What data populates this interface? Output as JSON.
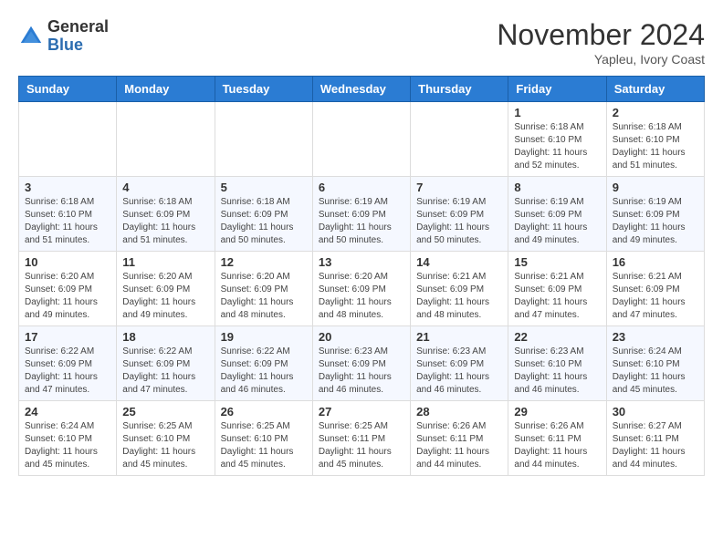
{
  "logo": {
    "general": "General",
    "blue": "Blue"
  },
  "title": "November 2024",
  "location": "Yapleu, Ivory Coast",
  "days_of_week": [
    "Sunday",
    "Monday",
    "Tuesday",
    "Wednesday",
    "Thursday",
    "Friday",
    "Saturday"
  ],
  "weeks": [
    [
      {
        "day": "",
        "detail": ""
      },
      {
        "day": "",
        "detail": ""
      },
      {
        "day": "",
        "detail": ""
      },
      {
        "day": "",
        "detail": ""
      },
      {
        "day": "",
        "detail": ""
      },
      {
        "day": "1",
        "detail": "Sunrise: 6:18 AM\nSunset: 6:10 PM\nDaylight: 11 hours and 52 minutes."
      },
      {
        "day": "2",
        "detail": "Sunrise: 6:18 AM\nSunset: 6:10 PM\nDaylight: 11 hours and 51 minutes."
      }
    ],
    [
      {
        "day": "3",
        "detail": "Sunrise: 6:18 AM\nSunset: 6:10 PM\nDaylight: 11 hours and 51 minutes."
      },
      {
        "day": "4",
        "detail": "Sunrise: 6:18 AM\nSunset: 6:09 PM\nDaylight: 11 hours and 51 minutes."
      },
      {
        "day": "5",
        "detail": "Sunrise: 6:18 AM\nSunset: 6:09 PM\nDaylight: 11 hours and 50 minutes."
      },
      {
        "day": "6",
        "detail": "Sunrise: 6:19 AM\nSunset: 6:09 PM\nDaylight: 11 hours and 50 minutes."
      },
      {
        "day": "7",
        "detail": "Sunrise: 6:19 AM\nSunset: 6:09 PM\nDaylight: 11 hours and 50 minutes."
      },
      {
        "day": "8",
        "detail": "Sunrise: 6:19 AM\nSunset: 6:09 PM\nDaylight: 11 hours and 49 minutes."
      },
      {
        "day": "9",
        "detail": "Sunrise: 6:19 AM\nSunset: 6:09 PM\nDaylight: 11 hours and 49 minutes."
      }
    ],
    [
      {
        "day": "10",
        "detail": "Sunrise: 6:20 AM\nSunset: 6:09 PM\nDaylight: 11 hours and 49 minutes."
      },
      {
        "day": "11",
        "detail": "Sunrise: 6:20 AM\nSunset: 6:09 PM\nDaylight: 11 hours and 49 minutes."
      },
      {
        "day": "12",
        "detail": "Sunrise: 6:20 AM\nSunset: 6:09 PM\nDaylight: 11 hours and 48 minutes."
      },
      {
        "day": "13",
        "detail": "Sunrise: 6:20 AM\nSunset: 6:09 PM\nDaylight: 11 hours and 48 minutes."
      },
      {
        "day": "14",
        "detail": "Sunrise: 6:21 AM\nSunset: 6:09 PM\nDaylight: 11 hours and 48 minutes."
      },
      {
        "day": "15",
        "detail": "Sunrise: 6:21 AM\nSunset: 6:09 PM\nDaylight: 11 hours and 47 minutes."
      },
      {
        "day": "16",
        "detail": "Sunrise: 6:21 AM\nSunset: 6:09 PM\nDaylight: 11 hours and 47 minutes."
      }
    ],
    [
      {
        "day": "17",
        "detail": "Sunrise: 6:22 AM\nSunset: 6:09 PM\nDaylight: 11 hours and 47 minutes."
      },
      {
        "day": "18",
        "detail": "Sunrise: 6:22 AM\nSunset: 6:09 PM\nDaylight: 11 hours and 47 minutes."
      },
      {
        "day": "19",
        "detail": "Sunrise: 6:22 AM\nSunset: 6:09 PM\nDaylight: 11 hours and 46 minutes."
      },
      {
        "day": "20",
        "detail": "Sunrise: 6:23 AM\nSunset: 6:09 PM\nDaylight: 11 hours and 46 minutes."
      },
      {
        "day": "21",
        "detail": "Sunrise: 6:23 AM\nSunset: 6:09 PM\nDaylight: 11 hours and 46 minutes."
      },
      {
        "day": "22",
        "detail": "Sunrise: 6:23 AM\nSunset: 6:10 PM\nDaylight: 11 hours and 46 minutes."
      },
      {
        "day": "23",
        "detail": "Sunrise: 6:24 AM\nSunset: 6:10 PM\nDaylight: 11 hours and 45 minutes."
      }
    ],
    [
      {
        "day": "24",
        "detail": "Sunrise: 6:24 AM\nSunset: 6:10 PM\nDaylight: 11 hours and 45 minutes."
      },
      {
        "day": "25",
        "detail": "Sunrise: 6:25 AM\nSunset: 6:10 PM\nDaylight: 11 hours and 45 minutes."
      },
      {
        "day": "26",
        "detail": "Sunrise: 6:25 AM\nSunset: 6:10 PM\nDaylight: 11 hours and 45 minutes."
      },
      {
        "day": "27",
        "detail": "Sunrise: 6:25 AM\nSunset: 6:11 PM\nDaylight: 11 hours and 45 minutes."
      },
      {
        "day": "28",
        "detail": "Sunrise: 6:26 AM\nSunset: 6:11 PM\nDaylight: 11 hours and 44 minutes."
      },
      {
        "day": "29",
        "detail": "Sunrise: 6:26 AM\nSunset: 6:11 PM\nDaylight: 11 hours and 44 minutes."
      },
      {
        "day": "30",
        "detail": "Sunrise: 6:27 AM\nSunset: 6:11 PM\nDaylight: 11 hours and 44 minutes."
      }
    ]
  ]
}
